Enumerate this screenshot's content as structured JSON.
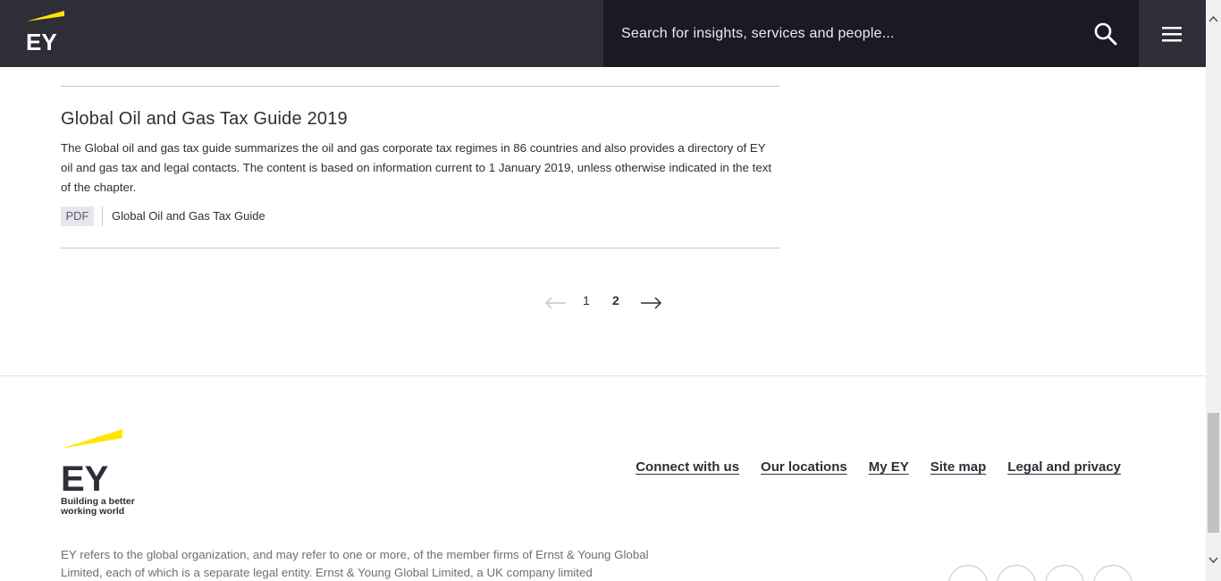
{
  "header": {
    "search_placeholder": "Search for insights, services and people...",
    "logo_text": "EY"
  },
  "article": {
    "title": "Global Oil and Gas Tax Guide 2019",
    "description": "The Global oil and gas tax guide summarizes the oil and gas corporate tax regimes in 86 countries and also provides a directory of EY oil and gas tax and legal contacts. The content is based on information current to 1 January 2019, unless otherwise indicated in the text of the chapter.",
    "file_type": "PDF",
    "file_link": "Global Oil and Gas Tax Guide"
  },
  "pagination": {
    "pages": [
      "1",
      "2"
    ],
    "current": "2"
  },
  "footer": {
    "logo_text": "EY",
    "tagline_1": "Building a better",
    "tagline_2": "working world",
    "links": [
      "Connect with us",
      "Our locations",
      "My EY",
      "Site map",
      "Legal and privacy"
    ],
    "legal_text": "EY refers to the global organization, and may refer to one or more, of the member firms of Ernst & Young Global Limited, each of which is a separate legal entity. Ernst & Young Global Limited, a UK company limited",
    "social_icons": [
      "facebook-icon",
      "linkedin-icon",
      "twitter-icon",
      "youtube-icon"
    ]
  },
  "colors": {
    "brand_yellow": "#ffe600",
    "header_bg": "#2e2e38",
    "search_bg": "#1a1a24"
  }
}
